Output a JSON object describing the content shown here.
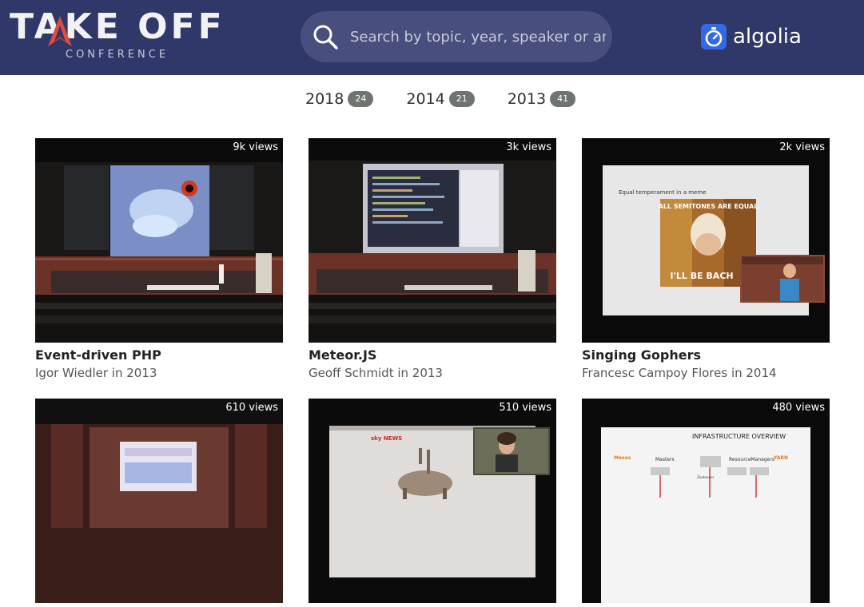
{
  "header": {
    "logo_title": "TAKE OFF",
    "logo_subtitle": "CONFERENCE",
    "search": {
      "placeholder": "Search by topic, year, speaker or anything else…"
    },
    "brand": "algolia",
    "colors": {
      "header_bg": "#303769",
      "search_bg": "#484e7d",
      "logo_accent": "#e04a3f",
      "algolia_blue": "#3369e7"
    }
  },
  "filters": {
    "years": [
      {
        "year": "2018",
        "count": "24"
      },
      {
        "year": "2014",
        "count": "21"
      },
      {
        "year": "2013",
        "count": "41"
      }
    ]
  },
  "talks": [
    {
      "title": "Event-driven PHP",
      "meta": "Igor Wiedler in 2013",
      "views": "9k views",
      "thumbnail": "conference-stage-black-hole-slide"
    },
    {
      "title": "Meteor.JS",
      "meta": "Geoff Schmidt in 2013",
      "views": "3k views",
      "thumbnail": "conference-stage-code-slide"
    },
    {
      "title": "Singing Gophers",
      "meta": "Francesc Campoy Flores in 2014",
      "views": "2k views",
      "thumbnail": "slide-meme-with-speaker-inset"
    },
    {
      "title": "",
      "meta": "",
      "views": "610 views",
      "thumbnail": "conference-room-stage"
    },
    {
      "title": "",
      "meta": "",
      "views": "510 views",
      "thumbnail": "news-clip-deer-with-speaker-inset"
    },
    {
      "title": "",
      "meta": "",
      "views": "480 views",
      "thumbnail": "infrastructure-overview-slide"
    }
  ],
  "slide_text": {
    "meme_caption": "Equal temperament in a meme",
    "meme_top": "ALL SEMITONES ARE EQUAL",
    "meme_bottom": "I'LL BE BACH",
    "news_logo": "sky NEWS",
    "infra_title": "INFRASTRUCTURE OVERVIEW",
    "infra_masters": "Masters",
    "infra_rm": "ResourceManagers",
    "infra_mesos": "Mesos",
    "infra_yarn": "YARN",
    "infra_zk": "Zookeeper"
  }
}
